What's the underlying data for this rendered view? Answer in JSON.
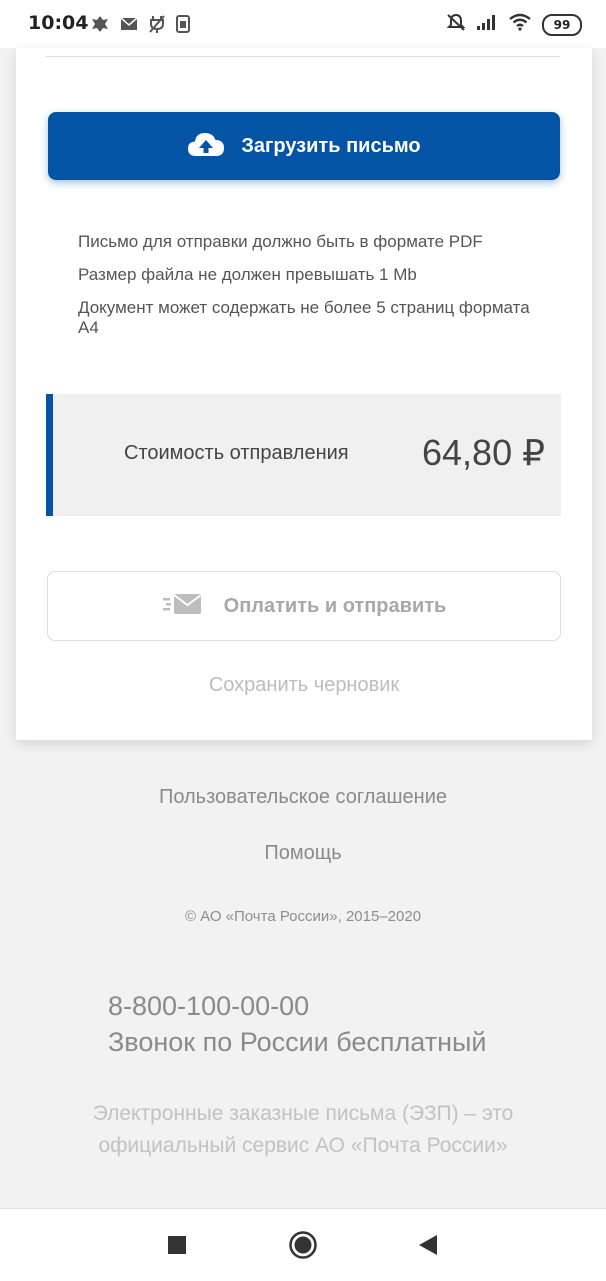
{
  "status_bar": {
    "time": "10:04",
    "battery": "99",
    "icons_left": [
      "emblem-icon",
      "mail-icon",
      "no-charge-icon",
      "sim-icon"
    ],
    "icons_right": [
      "mute-icon",
      "signal-icon",
      "wifi-icon",
      "battery-icon"
    ]
  },
  "upload": {
    "label": "Загрузить письмо",
    "icon": "cloud-upload-icon"
  },
  "rules": [
    "Письмо для отправки должно быть в формате PDF",
    "Размер файла не должен превышать 1 Mb",
    "Документ может содержать не более 5 страниц формата А4"
  ],
  "cost": {
    "label": "Стоимость отправления",
    "value": "64,80 ₽"
  },
  "pay": {
    "label": "Оплатить и отправить",
    "icon": "fast-mail-icon"
  },
  "draft": {
    "label": "Сохранить черновик"
  },
  "footer": {
    "agreement": "Пользовательское соглашение",
    "help": "Помощь",
    "copyright": "© АО «Почта России», 2015–2020",
    "phone": "8-800-100-00-00",
    "phone_note": "Звонок по России бесплатный",
    "service_line1": "Электронные заказные письма (ЭЗП) – это",
    "service_line2": "официальный сервис АО «Почта России»"
  },
  "nav": [
    "recent-apps-icon",
    "home-icon",
    "back-icon"
  ],
  "colors": {
    "brand_blue": "#0454a6",
    "background": "#f2f2f2",
    "muted_text": "#a8a8a8"
  }
}
